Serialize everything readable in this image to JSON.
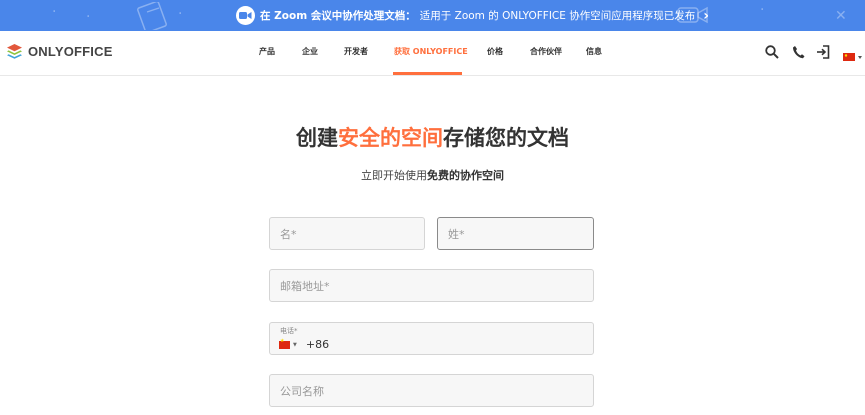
{
  "banner": {
    "bold_text": "在 Zoom 会议中协作处理文档：",
    "text": "适用于 Zoom 的 ONLYOFFICE 协作空间应用程序现已发布",
    "arrow": "›",
    "background": "#4a86ea"
  },
  "logo": {
    "text": "ONLYOFFICE"
  },
  "nav": {
    "items": [
      {
        "label": "产品"
      },
      {
        "label": "企业"
      },
      {
        "label": "开发者"
      },
      {
        "label": "获取 ONLYOFFICE"
      },
      {
        "label": "价格"
      },
      {
        "label": "合作伙伴"
      },
      {
        "label": "信息"
      }
    ],
    "active_index": 3
  },
  "header_icons": [
    "search-icon",
    "phone-icon",
    "sign-in-icon",
    "language-flag-icon"
  ],
  "hero": {
    "title_prefix": "创建",
    "title_accent": "安全的空间",
    "title_suffix": "存储您的文档",
    "subtitle_prefix": "立即开始使用",
    "subtitle_bold": "免费的协作空间"
  },
  "form": {
    "first_name_placeholder": "名*",
    "last_name_placeholder": "姓*",
    "email_placeholder": "邮箱地址*",
    "phone_label": "电话*",
    "phone_code": "+86",
    "company_placeholder": "公司名称"
  },
  "colors": {
    "accent": "#ff6f3d",
    "banner": "#4a86ea",
    "field_bg": "#f7f7f7"
  }
}
